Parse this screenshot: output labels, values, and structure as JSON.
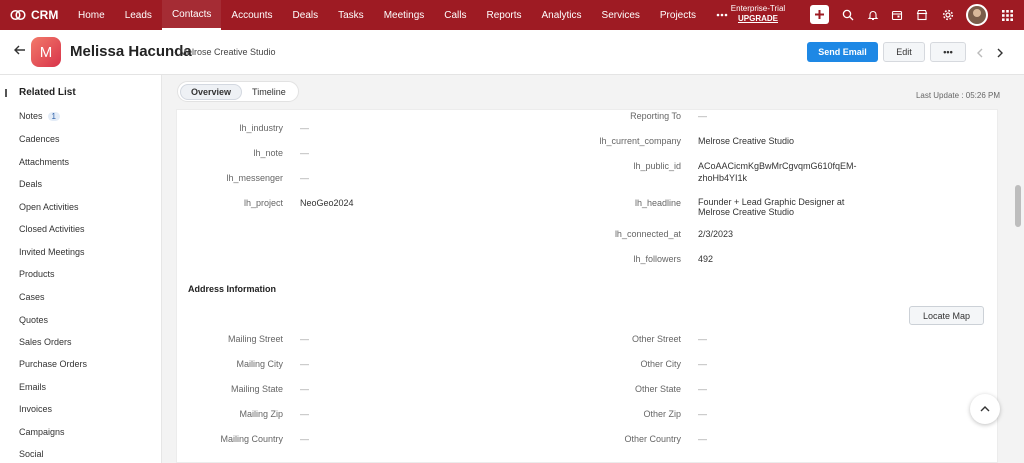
{
  "app": {
    "name": "CRM"
  },
  "nav": {
    "items": [
      "Home",
      "Leads",
      "Contacts",
      "Accounts",
      "Deals",
      "Tasks",
      "Meetings",
      "Calls",
      "Reports",
      "Analytics",
      "Services",
      "Projects"
    ],
    "active": "Contacts",
    "more_icon": "ellipsis-icon",
    "trial": "Enterprise-Trial",
    "upgrade": "UPGRADE"
  },
  "record": {
    "avatar_letter": "M",
    "name": "Melissa Hacunda",
    "company": "- Melrose Creative Studio",
    "send_email": "Send Email",
    "edit": "Edit",
    "more": "•••"
  },
  "sidebar": {
    "title": "Related List",
    "items": [
      {
        "label": "Notes",
        "badge": "1"
      },
      {
        "label": "Cadences"
      },
      {
        "label": "Attachments"
      },
      {
        "label": "Deals"
      },
      {
        "label": "Open Activities"
      },
      {
        "label": "Closed Activities"
      },
      {
        "label": "Invited Meetings"
      },
      {
        "label": "Products"
      },
      {
        "label": "Cases"
      },
      {
        "label": "Quotes"
      },
      {
        "label": "Sales Orders"
      },
      {
        "label": "Purchase Orders"
      },
      {
        "label": "Emails"
      },
      {
        "label": "Invoices"
      },
      {
        "label": "Campaigns"
      },
      {
        "label": "Social"
      }
    ]
  },
  "tabs": {
    "overview": "Overview",
    "timeline": "Timeline"
  },
  "last_update": "Last Update : 05:26 PM",
  "fields_left": [
    {
      "label": "lh_industry",
      "value": "—"
    },
    {
      "label": "lh_note",
      "value": "—"
    },
    {
      "label": "lh_messenger",
      "value": "—"
    },
    {
      "label": "lh_project",
      "value": "NeoGeo2024"
    }
  ],
  "fields_right": [
    {
      "label": "Reporting To",
      "value": "—"
    },
    {
      "label": "lh_current_company",
      "value": "Melrose Creative Studio"
    },
    {
      "label": "lh_public_id",
      "value": "ACoAACicmKgBwMrCgvqmG610fqEM-",
      "value2": "zhoHb4YI1k"
    },
    {
      "label": "lh_headline",
      "value": "Founder + Lead Graphic Designer at",
      "value2": "Melrose Creative Studio"
    },
    {
      "label": "lh_connected_at",
      "value": "2/3/2023"
    },
    {
      "label": "lh_followers",
      "value": "492"
    }
  ],
  "address": {
    "title": "Address Information",
    "locate_map": "Locate Map",
    "left": [
      {
        "label": "Mailing Street",
        "value": "—"
      },
      {
        "label": "Mailing City",
        "value": "—"
      },
      {
        "label": "Mailing State",
        "value": "—"
      },
      {
        "label": "Mailing Zip",
        "value": "—"
      },
      {
        "label": "Mailing Country",
        "value": "—"
      }
    ],
    "right": [
      {
        "label": "Other Street",
        "value": "—"
      },
      {
        "label": "Other City",
        "value": "—"
      },
      {
        "label": "Other State",
        "value": "—"
      },
      {
        "label": "Other Zip",
        "value": "—"
      },
      {
        "label": "Other Country",
        "value": "—"
      }
    ]
  }
}
